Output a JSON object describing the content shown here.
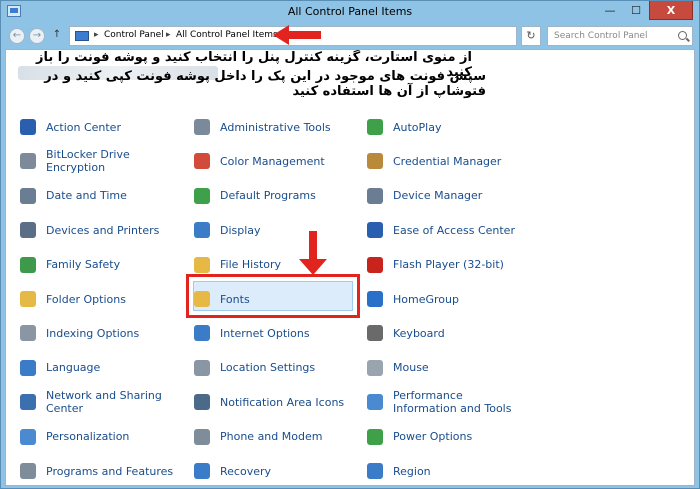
{
  "window": {
    "title": "All Control Panel Items",
    "minimize_glyph": "—",
    "maximize_glyph": "☐",
    "close_glyph": "X"
  },
  "address": {
    "back_glyph": "←",
    "forward_glyph": "→",
    "up_glyph": "↑",
    "crumbs": [
      "Control Panel",
      "All Control Panel Items"
    ],
    "separator": "▸",
    "refresh_glyph": "↻",
    "search_placeholder": "Search Control Panel"
  },
  "annotation": {
    "line1": "از منوی استارت، گزینه کنترل پنل را انتخاب کنید و پوشه فونت را باز کنید",
    "line2": "سپس فونت های موجود در این پک را داخل پوشه فونت کپی کنید و در فتوشاپ از آن ها استفاده کنید",
    "arrow_color": "#e2241f"
  },
  "columns": [
    {
      "items": [
        {
          "label": "Action Center",
          "icon": "flag-icon",
          "color": "#2a5fb0"
        },
        {
          "label": "BitLocker Drive Encryption",
          "icon": "drive-lock-icon",
          "color": "#7c8a99"
        },
        {
          "label": "Date and Time",
          "icon": "clock-icon",
          "color": "#6a7d92"
        },
        {
          "label": "Devices and Printers",
          "icon": "printer-icon",
          "color": "#5a6f86"
        },
        {
          "label": "Family Safety",
          "icon": "family-icon",
          "color": "#3d9a4a"
        },
        {
          "label": "Folder Options",
          "icon": "folder-icon",
          "color": "#e6b845"
        },
        {
          "label": "Indexing Options",
          "icon": "magnifier-icon",
          "color": "#8a96a4"
        },
        {
          "label": "Language",
          "icon": "globe-language-icon",
          "color": "#3a7cc8"
        },
        {
          "label": "Network and Sharing Center",
          "icon": "network-icon",
          "color": "#3b6fb0"
        },
        {
          "label": "Personalization",
          "icon": "monitor-paint-icon",
          "color": "#4b8ad0"
        },
        {
          "label": "Programs and Features",
          "icon": "programs-icon",
          "color": "#7f8c99"
        }
      ]
    },
    {
      "items": [
        {
          "label": "Administrative Tools",
          "icon": "admin-tools-icon",
          "color": "#7a8a9a"
        },
        {
          "label": "Color Management",
          "icon": "color-icon",
          "color": "#d24a3a"
        },
        {
          "label": "Default Programs",
          "icon": "default-programs-icon",
          "color": "#3fa04a"
        },
        {
          "label": "Display",
          "icon": "display-icon",
          "color": "#3a7cc8"
        },
        {
          "label": "File History",
          "icon": "file-history-icon",
          "color": "#e6b845"
        },
        {
          "label": "Fonts",
          "icon": "font-folder-icon",
          "color": "#e6b845"
        },
        {
          "label": "Internet Options",
          "icon": "internet-icon",
          "color": "#3a7cc8"
        },
        {
          "label": "Location Settings",
          "icon": "location-icon",
          "color": "#8a96a4"
        },
        {
          "label": "Notification Area Icons",
          "icon": "notification-icon",
          "color": "#4b6a8a"
        },
        {
          "label": "Phone and Modem",
          "icon": "phone-icon",
          "color": "#7f8c99"
        },
        {
          "label": "Recovery",
          "icon": "recovery-icon",
          "color": "#3a7cc8"
        }
      ]
    },
    {
      "items": [
        {
          "label": "AutoPlay",
          "icon": "autoplay-icon",
          "color": "#3fa04a"
        },
        {
          "label": "Credential Manager",
          "icon": "credential-icon",
          "color": "#b88a3a"
        },
        {
          "label": "Device Manager",
          "icon": "device-manager-icon",
          "color": "#6a7d92"
        },
        {
          "label": "Ease of Access Center",
          "icon": "ease-access-icon",
          "color": "#2a5fb0"
        },
        {
          "label": "Flash Player (32-bit)",
          "icon": "flash-icon",
          "color": "#c8241c"
        },
        {
          "label": "HomeGroup",
          "icon": "homegroup-icon",
          "color": "#2a6fc8"
        },
        {
          "label": "Keyboard",
          "icon": "keyboard-icon",
          "color": "#6a6a6a"
        },
        {
          "label": "Mouse",
          "icon": "mouse-icon",
          "color": "#9aa4ae"
        },
        {
          "label": "Performance Information and Tools",
          "icon": "performance-icon",
          "color": "#4b8ad0"
        },
        {
          "label": "Power Options",
          "icon": "power-icon",
          "color": "#3fa04a"
        },
        {
          "label": "Region",
          "icon": "region-globe-icon",
          "color": "#3a7cc8"
        }
      ]
    }
  ]
}
